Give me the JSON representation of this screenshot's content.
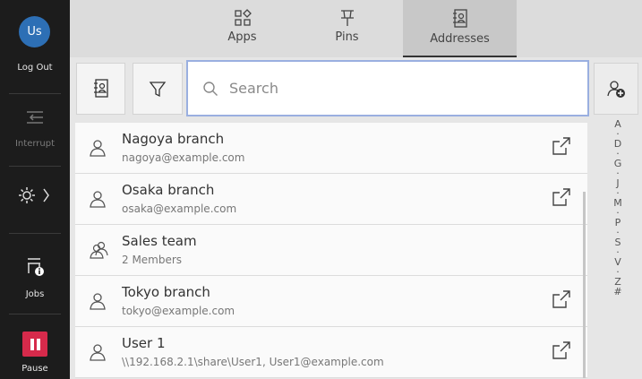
{
  "sidebar": {
    "avatar_initials": "Us",
    "logout_label": "Log Out",
    "interrupt_label": "Interrupt",
    "jobs_label": "Jobs",
    "pause_label": "Pause"
  },
  "tabs": [
    {
      "label": "Apps",
      "icon": "apps-icon"
    },
    {
      "label": "Pins",
      "icon": "pin-icon"
    },
    {
      "label": "Addresses",
      "icon": "address-book-icon",
      "active": true
    }
  ],
  "search": {
    "placeholder": "Search",
    "value": ""
  },
  "entries": [
    {
      "name": "Nagoya branch",
      "detail": "nagoya@example.com",
      "type": "person"
    },
    {
      "name": "Osaka branch",
      "detail": "osaka@example.com",
      "type": "person"
    },
    {
      "name": "Sales team",
      "detail": "2 Members",
      "type": "group"
    },
    {
      "name": "Tokyo branch",
      "detail": "tokyo@example.com",
      "type": "person"
    },
    {
      "name": "User 1",
      "detail": "\\\\192.168.2.1\\share\\User1, User1@example.com",
      "type": "person"
    }
  ],
  "index": [
    "A",
    "·",
    "D",
    "·",
    "G",
    "·",
    "J",
    "·",
    "M",
    "·",
    "P",
    "·",
    "S",
    "·",
    "V",
    "·",
    "Z",
    "#"
  ],
  "colors": {
    "accent": "#2d6fb5",
    "pause": "#d62a4b",
    "search_border": "#9aafe0"
  }
}
